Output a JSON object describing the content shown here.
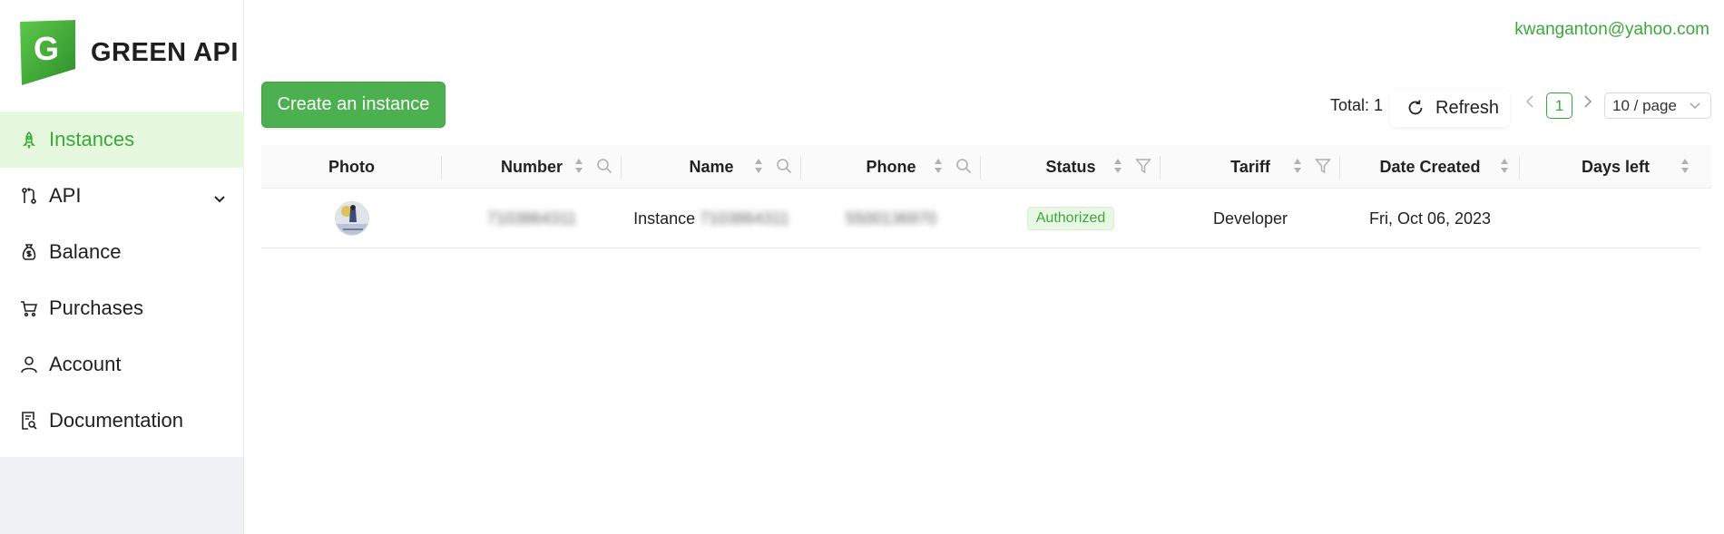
{
  "brand": {
    "name": "GREEN API",
    "logo_letter": "G",
    "color": "#4caf50"
  },
  "user": {
    "email": "kwanganton@yahoo.com"
  },
  "sidebar": {
    "items": [
      {
        "label": "Instances",
        "icon": "rocket-icon",
        "active": true
      },
      {
        "label": "API",
        "icon": "branch-icon",
        "has_submenu": true
      },
      {
        "label": "Balance",
        "icon": "money-bag-icon"
      },
      {
        "label": "Purchases",
        "icon": "cart-icon"
      },
      {
        "label": "Account",
        "icon": "user-icon"
      },
      {
        "label": "Documentation",
        "icon": "document-search-icon"
      }
    ]
  },
  "toolbar": {
    "create_label": "Create an instance",
    "total_label": "Total: 1",
    "refresh_label": "Refresh",
    "current_page": "1",
    "page_size": "10 / page"
  },
  "table": {
    "columns": [
      {
        "label": "Photo"
      },
      {
        "label": "Number",
        "sortable": true,
        "searchable": true
      },
      {
        "label": "Name",
        "sortable": true,
        "searchable": true
      },
      {
        "label": "Phone",
        "sortable": true,
        "searchable": true
      },
      {
        "label": "Status",
        "sortable": true,
        "filterable": true
      },
      {
        "label": "Tariff",
        "sortable": true,
        "filterable": true
      },
      {
        "label": "Date Created",
        "sortable": true
      },
      {
        "label": "Days left",
        "sortable": true
      }
    ],
    "rows": [
      {
        "number": "7103864311",
        "name_prefix": "Instance",
        "name_suffix": "7103864311",
        "phone": "5500136970",
        "status": "Authorized",
        "tariff": "Developer",
        "date_created": "Fri, Oct 06, 2023",
        "days_left": ""
      }
    ]
  },
  "colors": {
    "accent": "#3aa83a",
    "button": "#4caf50",
    "active_bg": "#e6f9df"
  }
}
